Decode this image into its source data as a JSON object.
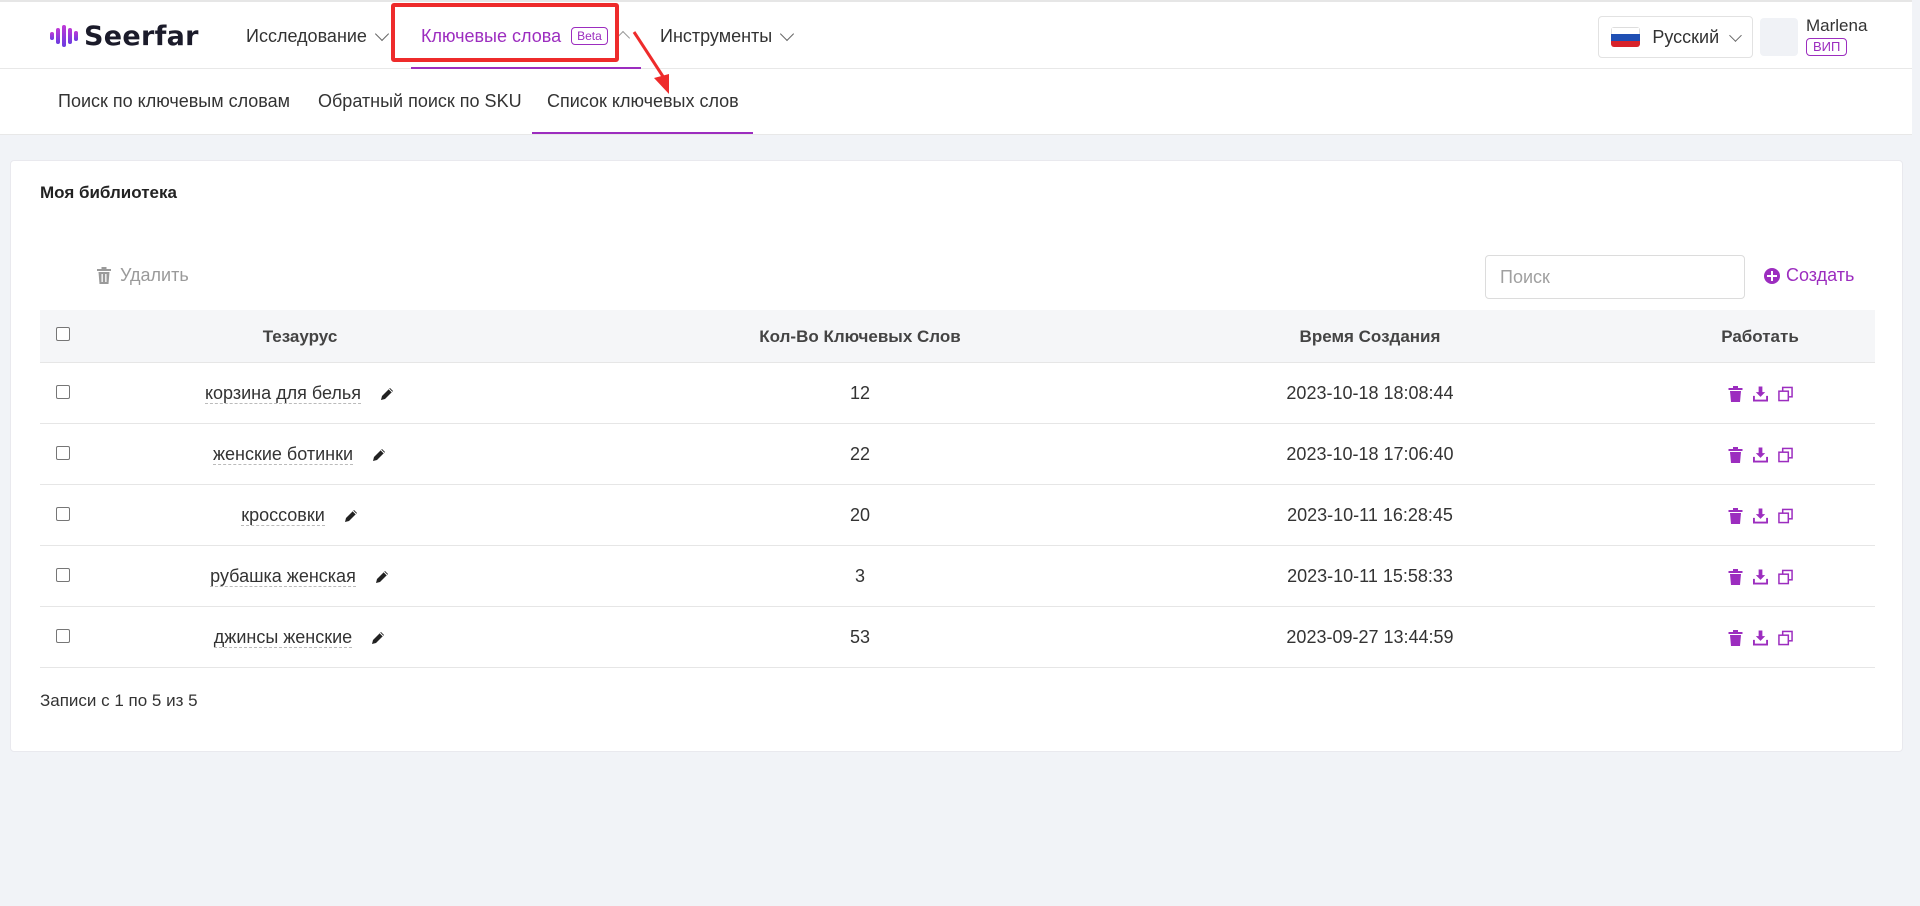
{
  "brand": {
    "name": "Seerfar"
  },
  "nav": {
    "items": [
      {
        "label": "Исследование"
      },
      {
        "label": "Ключевые слова",
        "badge": "Beta"
      },
      {
        "label": "Инструменты"
      }
    ]
  },
  "language": {
    "selected": "Русский"
  },
  "user": {
    "name": "Marlena",
    "badge": "ВИП"
  },
  "subnav": {
    "tabs": [
      {
        "label": "Поиск по ключевым словам"
      },
      {
        "label": "Обратный поиск по SKU"
      },
      {
        "label": "Список ключевых слов"
      }
    ]
  },
  "library": {
    "title": "Моя библиотека",
    "delete_label": "Удалить",
    "search_placeholder": "Поиск",
    "create_label": "Создать",
    "columns": [
      "Тезаурус",
      "Кол-Во Ключевых Слов",
      "Время Создания",
      "Работать"
    ],
    "rows": [
      {
        "name": "корзина для белья",
        "count": "12",
        "created": "2023-10-18 18:08:44"
      },
      {
        "name": "женские ботинки",
        "count": "22",
        "created": "2023-10-18 17:06:40"
      },
      {
        "name": "кроссовки",
        "count": "20",
        "created": "2023-10-11 16:28:45"
      },
      {
        "name": "рубашка женская",
        "count": "3",
        "created": "2023-10-11 15:58:33"
      },
      {
        "name": "джинсы женские",
        "count": "53",
        "created": "2023-09-27 13:44:59"
      }
    ],
    "records_text": "Записи с 1 по 5 из 5"
  },
  "colors": {
    "accent": "#9c2dbf",
    "highlight": "#ee2b2b"
  }
}
